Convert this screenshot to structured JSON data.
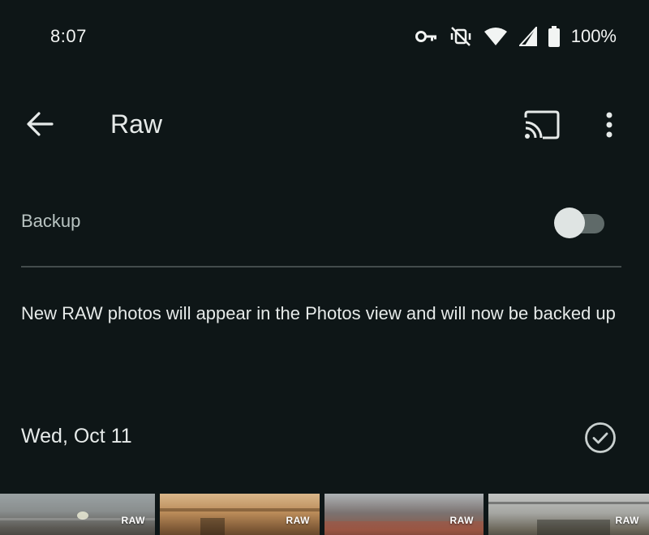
{
  "status_bar": {
    "time": "8:07",
    "icons": [
      "vpn-key-icon",
      "vibrate-off-icon",
      "wifi-icon",
      "cell-signal-icon",
      "battery-icon"
    ],
    "battery": "100%"
  },
  "app_bar": {
    "title": "Raw",
    "back_icon": "arrow-left-icon",
    "cast_icon": "cast-icon",
    "more_icon": "more-vert-icon"
  },
  "backup": {
    "label": "Backup",
    "toggle_on": false
  },
  "info": {
    "text": "New RAW photos will appear in the Photos view and will now be backed up"
  },
  "date_group": {
    "label": "Wed, Oct 11",
    "select_icon": "check-circle-icon"
  },
  "thumbnails": [
    {
      "badge": "RAW"
    },
    {
      "badge": "RAW"
    },
    {
      "badge": "RAW"
    },
    {
      "badge": "RAW"
    }
  ],
  "colors": {
    "background": "#0e1617",
    "text": "#e6eae9",
    "secondary_text": "#b9c4c2",
    "divider": "#434c4c",
    "toggle_track": "#5f6a69",
    "toggle_thumb": "#dfe4e3"
  }
}
